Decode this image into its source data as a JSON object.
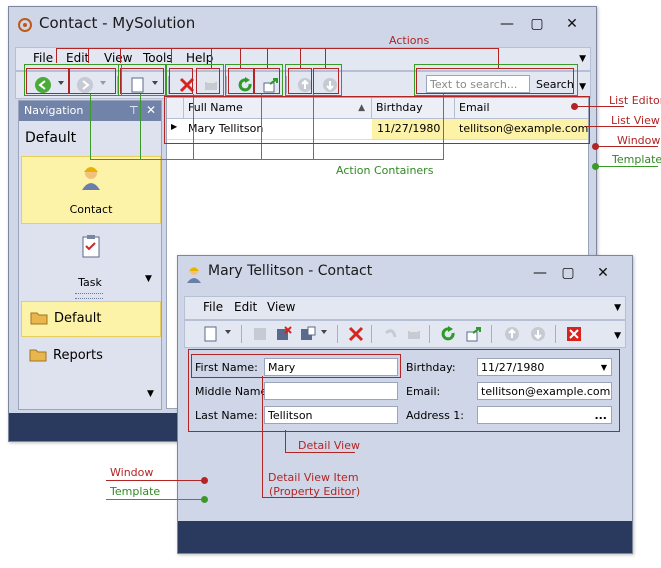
{
  "main_window": {
    "title": "Contact - MySolution",
    "menu": [
      "File",
      "Edit",
      "View",
      "Tools",
      "Help"
    ],
    "search_placeholder": "Text to search...",
    "search_button": "Search",
    "grid": {
      "columns": [
        "Full Name",
        "Birthday",
        "Email"
      ],
      "rows": [
        [
          "Mary Tellitson",
          "11/27/1980",
          "tellitson@example.com"
        ]
      ]
    }
  },
  "navigation": {
    "title": "Navigation",
    "group_default": "Default",
    "items": [
      "Contact",
      "Task"
    ],
    "groups": [
      "Default",
      "Reports"
    ]
  },
  "detail_window": {
    "title": "Mary Tellitson  - Contact",
    "menu": [
      "File",
      "Edit",
      "View"
    ],
    "fields": {
      "first_name_label": "First Name:",
      "first_name_value": "Mary",
      "middle_name_label": "Middle Name:",
      "middle_name_value": "",
      "last_name_label": "Last Name:",
      "last_name_value": "Tellitson",
      "birthday_label": "Birthday:",
      "birthday_value": "11/27/1980",
      "email_label": "Email:",
      "email_value": "tellitson@example.com",
      "address_label": "Address 1:",
      "address_value": "..."
    }
  },
  "annotations": {
    "actions": "Actions",
    "action_containers": "Action Containers",
    "list_editor": "List Editor",
    "list_view": "List View",
    "window": "Window",
    "template": "Template",
    "detail_view": "Detail View",
    "detail_view_item_line1": "Detail View Item",
    "detail_view_item_line2": "(Property Editor)",
    "window2": "Window",
    "template2": "Template"
  },
  "colors": {
    "annotation_red": "#b32424",
    "annotation_green": "#3a9a27",
    "window_bg": "#cfd6e8",
    "selection": "#fdf3a8"
  }
}
